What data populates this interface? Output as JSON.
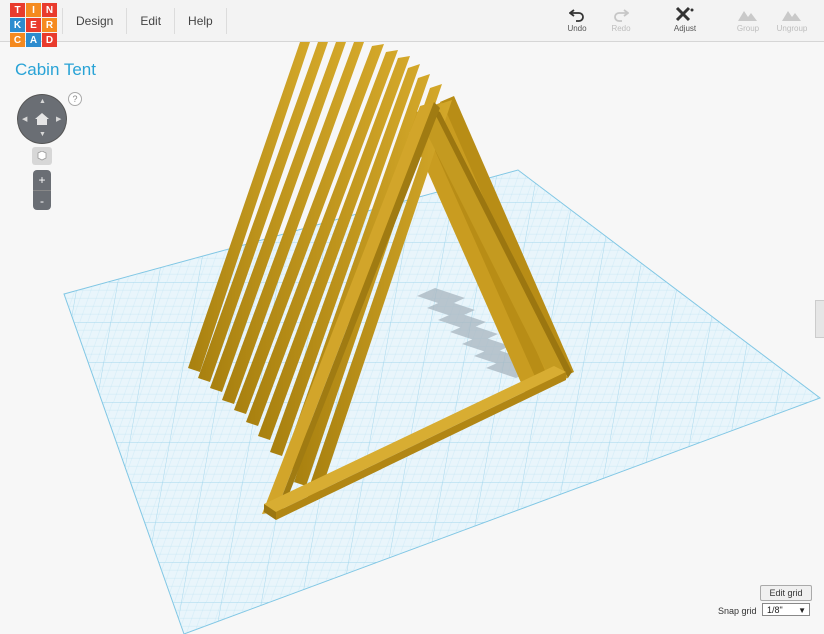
{
  "logo": {
    "letters": [
      "T",
      "I",
      "N",
      "K",
      "E",
      "R",
      "C",
      "A",
      "D"
    ]
  },
  "menu": {
    "design": "Design",
    "edit": "Edit",
    "help": "Help"
  },
  "toolbar": {
    "undo": "Undo",
    "redo": "Redo",
    "adjust": "Adjust",
    "group": "Group",
    "ungroup": "Ungroup"
  },
  "workspace": {
    "title": "Cabin Tent",
    "help": "?"
  },
  "view": {
    "zoom_in": "+",
    "zoom_out": "-"
  },
  "grid": {
    "edit_label": "Edit grid",
    "snap_label": "Snap grid",
    "snap_value": "1/8\""
  },
  "colors": {
    "accent": "#29a3d6",
    "plank": "#c59a1e",
    "grid_line": "#a5d9ee"
  },
  "icons": [
    "undo-icon",
    "redo-icon",
    "adjust-icon",
    "group-icon",
    "ungroup-icon",
    "home-icon",
    "fit-view-icon"
  ]
}
